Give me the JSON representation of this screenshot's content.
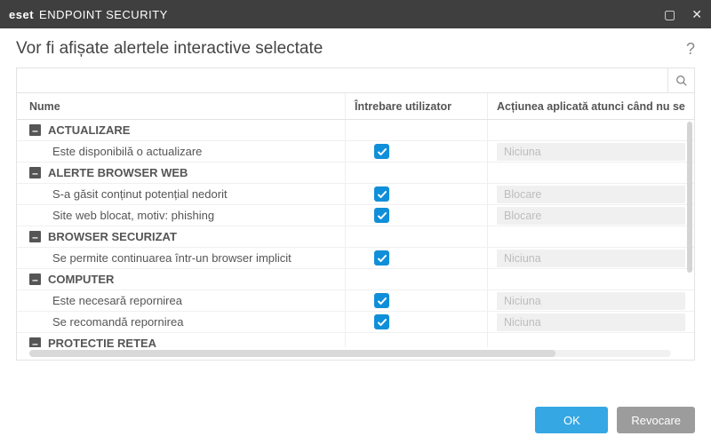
{
  "brand": {
    "eset": "eset",
    "product": "ENDPOINT SECURITY"
  },
  "heading": "Vor fi afișate alertele interactive selectate",
  "columns": {
    "name": "Nume",
    "ask": "Întrebare utilizator",
    "action": "Acțiunea aplicată atunci când nu se"
  },
  "groups": [
    {
      "label": "ACTUALIZARE",
      "items": [
        {
          "name": "Este disponibilă o actualizare",
          "checked": true,
          "action": "Niciuna"
        }
      ]
    },
    {
      "label": "ALERTE BROWSER WEB",
      "items": [
        {
          "name": "S-a găsit conținut potențial nedorit",
          "checked": true,
          "action": "Blocare"
        },
        {
          "name": "Site web blocat, motiv: phishing",
          "checked": true,
          "action": "Blocare"
        }
      ]
    },
    {
      "label": "BROWSER SECURIZAT",
      "items": [
        {
          "name": "Se permite continuarea într-un browser implicit",
          "checked": true,
          "action": "Niciuna"
        }
      ]
    },
    {
      "label": "COMPUTER",
      "items": [
        {
          "name": "Este necesară repornirea",
          "checked": true,
          "action": "Niciuna"
        },
        {
          "name": "Se recomandă repornirea",
          "checked": true,
          "action": "Niciuna"
        }
      ]
    },
    {
      "label": "PROTECȚIE REȚEA",
      "items": []
    }
  ],
  "buttons": {
    "ok": "OK",
    "cancel": "Revocare"
  },
  "search": {
    "placeholder": ""
  },
  "icons": {
    "collapse": "–"
  }
}
